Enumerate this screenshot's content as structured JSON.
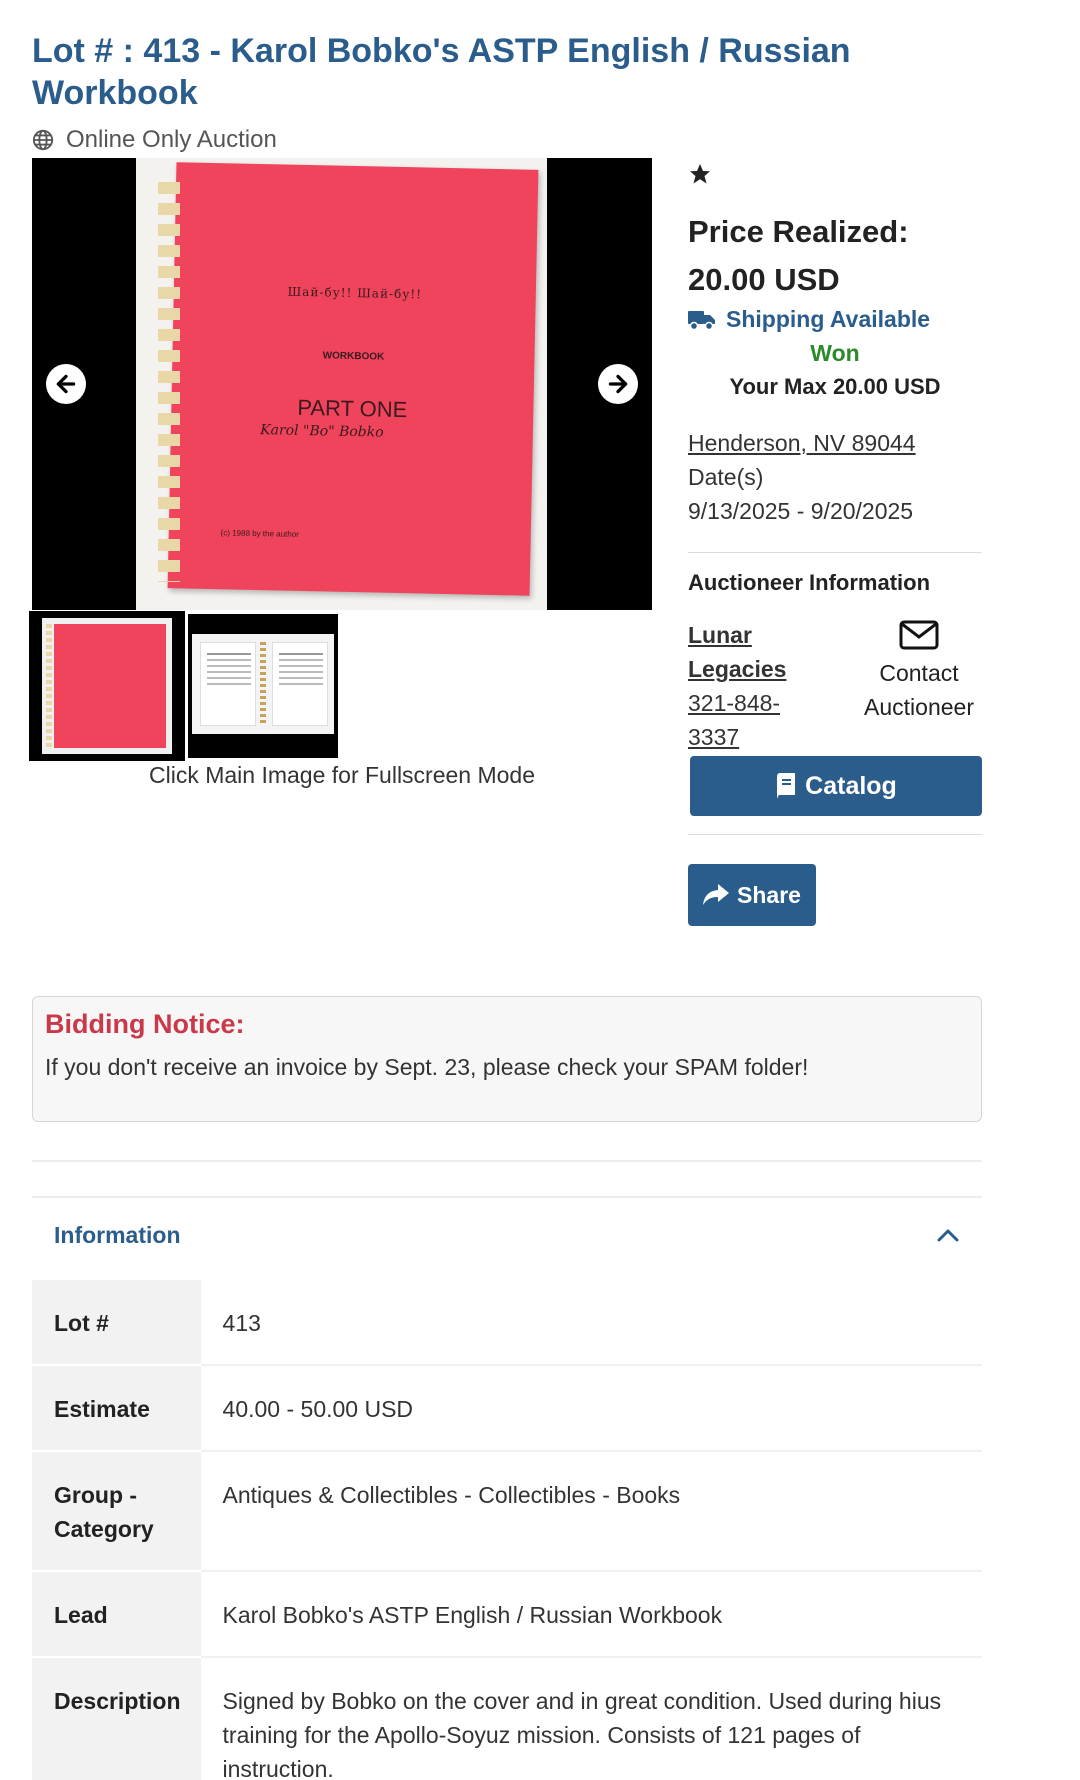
{
  "lot": {
    "title": "Lot # : 413 - Karol Bobko's ASTP English / Russian Workbook",
    "auction_type": "Online Only Auction"
  },
  "gallery": {
    "main_image_alt": "Karol Bobko's ASTP English / Russian Workbook",
    "cover_line1": "Шай-бу!!   Шай-бу!!",
    "cover_line2": "WORKBOOK",
    "cover_line3": "PART ONE",
    "cover_signature": "Karol \"Bo\" Bobko",
    "cover_copyright": "(c) 1988 by the author",
    "hint": "Click Main Image for Fullscreen Mode"
  },
  "sidebar": {
    "price_label": "Price Realized:",
    "price_value": "20.00 USD",
    "shipping": "Shipping Available",
    "status": "Won",
    "max_bid": "Your Max 20.00 USD",
    "location": "Henderson, NV 89044",
    "dates_label": "Date(s)",
    "dates_value": "9/13/2025 - 9/20/2025",
    "auctioneer_heading": "Auctioneer Information",
    "auctioneer_name": "Lunar Legacies",
    "auctioneer_phone": "321-848-3337",
    "contact_label": "Contact Auctioneer",
    "catalog_label": "Catalog",
    "share_label": "Share"
  },
  "notice": {
    "title": "Bidding Notice:",
    "text": "If you don't receive an invoice by Sept. 23, please check your SPAM folder!"
  },
  "information": {
    "heading": "Information",
    "rows": [
      {
        "key": "Lot #",
        "value": "413"
      },
      {
        "key": "Estimate",
        "value": "40.00 - 50.00 USD"
      },
      {
        "key": "Group - Category",
        "value": "Antiques & Collectibles - Collectibles - Books"
      },
      {
        "key": "Lead",
        "value": "Karol Bobko's ASTP English / Russian Workbook"
      },
      {
        "key": "Description",
        "value": "Signed by Bobko on the cover and in great condition. Used during hius training for the Apollo-Soyuz mission. Consists of 121 pages of instruction."
      }
    ]
  },
  "colors": {
    "accent": "#2a5d8c",
    "won": "#2c8a2c",
    "notice_title": "#c9394a"
  },
  "icons": [
    "globe-icon",
    "arrow-left-icon",
    "arrow-right-icon",
    "star-icon",
    "truck-icon",
    "envelope-icon",
    "book-icon",
    "share-icon",
    "chevron-up-icon"
  ]
}
